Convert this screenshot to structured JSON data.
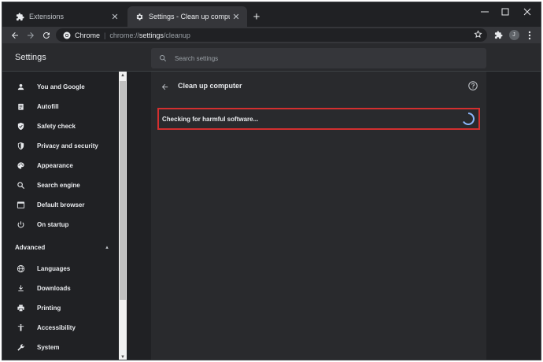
{
  "tabs": [
    {
      "title": "Extensions",
      "close": "✕",
      "active": false
    },
    {
      "title": "Settings - Clean up computer",
      "close": "✕",
      "active": true
    }
  ],
  "new_tab": "+",
  "window_controls": {
    "minimize": "—",
    "maximize": "☐",
    "close": "✕"
  },
  "omnibox": {
    "site_label": "Chrome",
    "separator": "|",
    "url_scheme": "chrome://",
    "url_host": "settings",
    "url_path": "/cleanup"
  },
  "profile": {
    "initial": "J"
  },
  "settings": {
    "title": "Settings",
    "search_placeholder": "Search settings"
  },
  "sidebar": {
    "items": [
      {
        "label": "You and Google",
        "icon": "person-icon"
      },
      {
        "label": "Autofill",
        "icon": "clipboard-icon"
      },
      {
        "label": "Safety check",
        "icon": "shield-check-icon"
      },
      {
        "label": "Privacy and security",
        "icon": "shield-icon"
      },
      {
        "label": "Appearance",
        "icon": "palette-icon"
      },
      {
        "label": "Search engine",
        "icon": "search-icon"
      },
      {
        "label": "Default browser",
        "icon": "browser-icon"
      },
      {
        "label": "On startup",
        "icon": "power-icon"
      }
    ],
    "advanced_label": "Advanced",
    "advanced_items": [
      {
        "label": "Languages",
        "icon": "globe-icon"
      },
      {
        "label": "Downloads",
        "icon": "download-icon"
      },
      {
        "label": "Printing",
        "icon": "printer-icon"
      },
      {
        "label": "Accessibility",
        "icon": "accessibility-icon"
      },
      {
        "label": "System",
        "icon": "wrench-icon"
      }
    ]
  },
  "main": {
    "page_title": "Clean up computer",
    "status_text": "Checking for harmful software..."
  },
  "colors": {
    "background": "#202124",
    "card": "#292a2d",
    "accent": "#8ab4f8",
    "highlight_border": "#d32f2f"
  }
}
